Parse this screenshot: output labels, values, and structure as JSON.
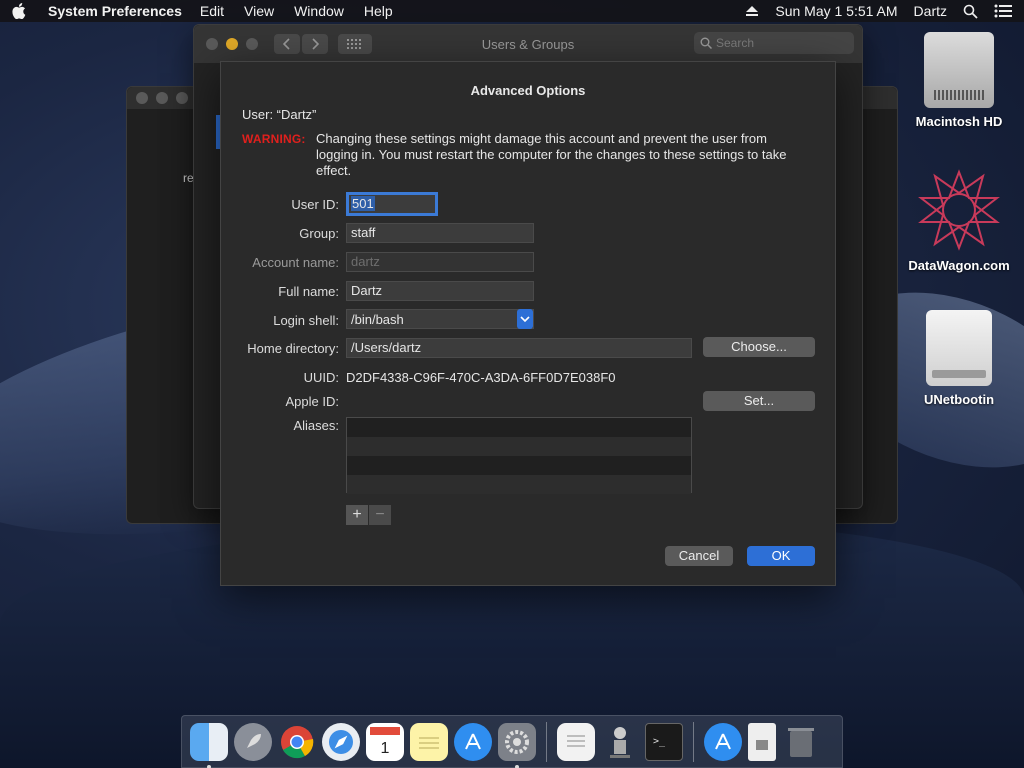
{
  "menubar": {
    "app_name": "System Preferences",
    "menus": [
      "Edit",
      "View",
      "Window",
      "Help"
    ],
    "clock": "Sun May 1  5:51 AM",
    "user": "Dartz"
  },
  "window": {
    "title": "Users & Groups",
    "search_placeholder": "Search",
    "background_text": "re"
  },
  "sheet": {
    "title": "Advanced Options",
    "user_line": "User:  “Dartz”",
    "warning_label": "WARNING:",
    "warning_text": "Changing these settings might damage this account and prevent the user from logging in. You must restart the computer for the changes to these settings to take effect.",
    "fields": {
      "user_id": {
        "label": "User ID:",
        "value": "501"
      },
      "group": {
        "label": "Group:",
        "value": "staff"
      },
      "account_name": {
        "label": "Account name:",
        "value": "dartz"
      },
      "full_name": {
        "label": "Full name:",
        "value": "Dartz"
      },
      "login_shell": {
        "label": "Login shell:",
        "value": "/bin/bash"
      },
      "home_directory": {
        "label": "Home directory:",
        "value": "/Users/dartz"
      },
      "uuid": {
        "label": "UUID:",
        "value": "D2DF4338-C96F-470C-A3DA-6FF0D7E038F0"
      },
      "apple_id": {
        "label": "Apple ID:",
        "value": ""
      },
      "aliases": {
        "label": "Aliases:"
      }
    },
    "choose_button": "Choose...",
    "set_button": "Set...",
    "plus": "+",
    "minus": "−",
    "cancel_button": "Cancel",
    "ok_button": "OK"
  },
  "desktop": {
    "icons": [
      {
        "label": "Macintosh HD"
      },
      {
        "label": "DataWagon.com"
      },
      {
        "label": "UNetbootin"
      }
    ]
  },
  "colors": {
    "accent": "#2d6fd6",
    "warning": "#e0201d"
  }
}
